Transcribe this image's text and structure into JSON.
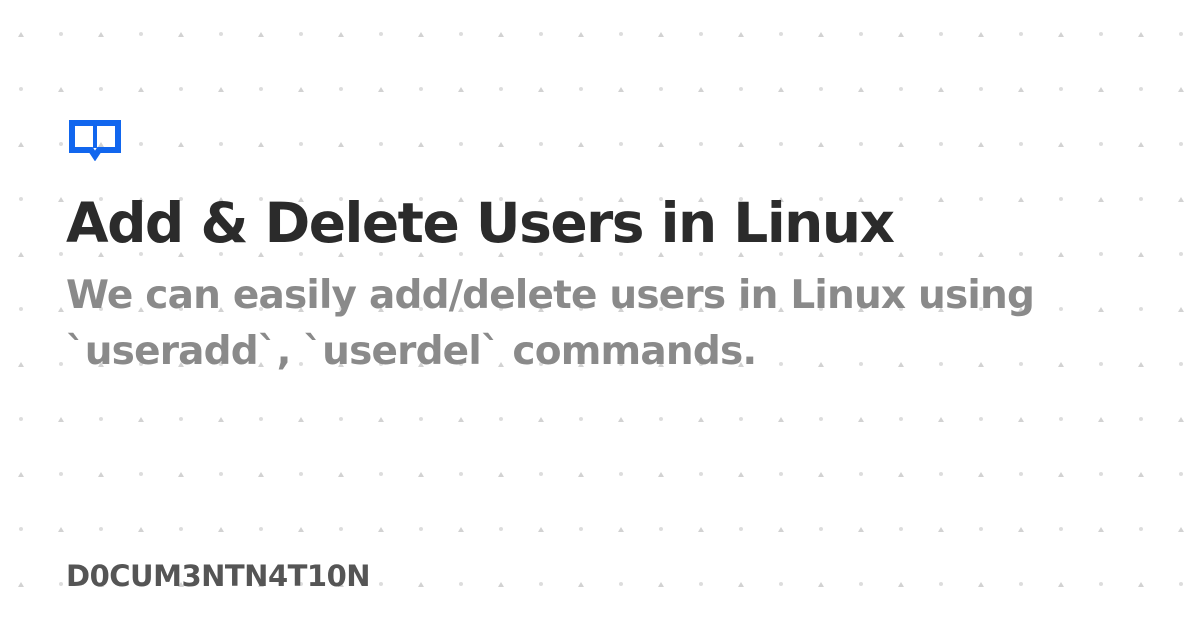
{
  "logo": {
    "icon": "open-book-icon",
    "color": "#1166ee"
  },
  "title": "Add & Delete Users in Linux",
  "description": "We can easily add/delete users in Linux using `useradd`, `userdel` commands.",
  "site_name": "D0CUM3NTN4T10N",
  "colors": {
    "background": "#ffffff",
    "title": "#2b2b2b",
    "description": "#8a8a8a",
    "site_name": "#555555",
    "pattern_dot": "#d0d0d0"
  }
}
